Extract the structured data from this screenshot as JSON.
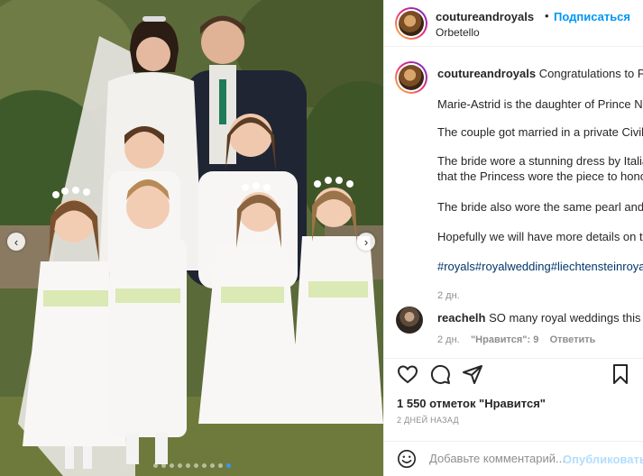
{
  "post": {
    "username": "coutureandroyals",
    "separator": "•",
    "follow_label": "Подписаться",
    "location": "Orbetello"
  },
  "caption": {
    "username": "coutureandroyals",
    "line1": "Congratulations to Prin",
    "line2": "Marie-Astrid is the daughter of Prince Niko",
    "line3": "The couple got married in a private Civil C",
    "line4": "The bride wore a stunning dress by Italian",
    "line5": "that the Princess wore the piece to honou",
    "line6": "The bride also wore the same pearl and di",
    "line7": "Hopefully we will have more details on the",
    "hashtags": "#royals#royalwedding#liechtensteinroyals",
    "age": "2 дн."
  },
  "comment": {
    "username": "reachelh",
    "text": "SO many royal weddings this yea",
    "age": "2 дн.",
    "likes_label": "\"Нравится\": 9",
    "reply_label": "Ответить"
  },
  "likes_text": "1 550 отметок \"Нравится\"",
  "timestamp": "2 ДНЕЙ НАЗАД",
  "add_comment": {
    "placeholder": "Добавьте комментарий...",
    "post_label": "Опубликовать"
  },
  "carousel": {
    "prev_icon": "chevron-left-icon",
    "next_icon": "chevron-right-icon",
    "slides": 10,
    "active_slide": 10
  },
  "icons": [
    "heart-icon",
    "comment-icon",
    "share-icon",
    "bookmark-icon",
    "emoji-icon"
  ],
  "colors": {
    "link": "#0095f6",
    "hashtag": "#00376b",
    "muted": "#8e8e8e",
    "post_disabled": "#b2dffc"
  }
}
